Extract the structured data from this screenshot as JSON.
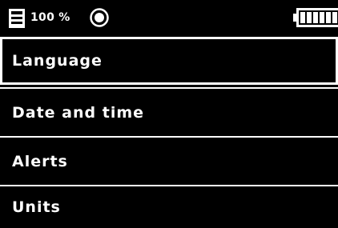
{
  "status_bar": {
    "zoom": "100 %",
    "storage_icon": "sd-card-icon",
    "record_icon": "record-icon",
    "battery_icon": "battery-full-icon"
  },
  "menu": {
    "items": [
      {
        "label": "Language",
        "selected": true
      },
      {
        "label": "Date and time",
        "selected": false
      },
      {
        "label": "Alerts",
        "selected": false
      },
      {
        "label": "Units",
        "selected": false
      }
    ]
  },
  "colors": {
    "background": "#000000",
    "foreground": "#ffffff"
  }
}
